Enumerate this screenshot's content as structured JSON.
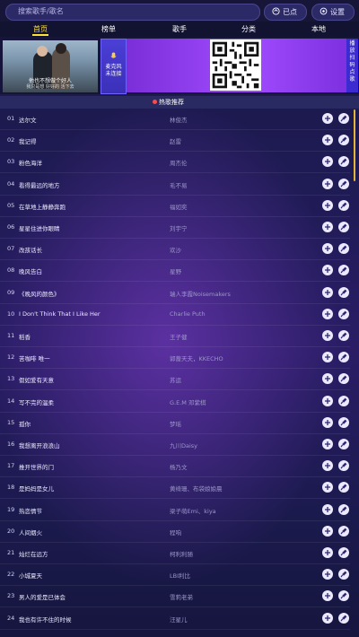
{
  "search": {
    "placeholder": "搜索歌手/歌名"
  },
  "header": {
    "queued_label": "已点",
    "settings_label": "设置"
  },
  "tabs": [
    {
      "label": "首页",
      "active": true
    },
    {
      "label": "榜单",
      "active": false
    },
    {
      "label": "歌手",
      "active": false
    },
    {
      "label": "分类",
      "active": false
    },
    {
      "label": "本地",
      "active": false
    }
  ],
  "banner": {
    "video_subtitle": "他也不想做个好人",
    "video_subtitle_small": "我只是想 好好的 活下去",
    "mic_label": [
      "麦克风",
      "未连接"
    ],
    "side_label": [
      "播",
      "放",
      "扫",
      "码",
      "点",
      "歌"
    ]
  },
  "section": {
    "title": "热歌推荐"
  },
  "songs": [
    {
      "num": "01",
      "title": "达尔文",
      "artist": "林俊杰"
    },
    {
      "num": "02",
      "title": "我记得",
      "artist": "赵雷"
    },
    {
      "num": "03",
      "title": "粉色海洋",
      "artist": "周杰伦"
    },
    {
      "num": "04",
      "title": "看得最远的地方",
      "artist": "毛不易"
    },
    {
      "num": "05",
      "title": "在草地上静静奔跑",
      "artist": "福如奕"
    },
    {
      "num": "06",
      "title": "星星住进你眼睛",
      "artist": "刘宇宁"
    },
    {
      "num": "07",
      "title": "改孩话长",
      "artist": "欢沙"
    },
    {
      "num": "08",
      "title": "晚风告白",
      "artist": "星野"
    },
    {
      "num": "09",
      "title": "《晚风的颜色》",
      "artist": "瑞人李霞Noisemakers"
    },
    {
      "num": "10",
      "title": "I Don't Think That I Like Her",
      "artist": "Charlie Puth"
    },
    {
      "num": "11",
      "title": "稻香",
      "artist": "王子健"
    },
    {
      "num": "12",
      "title": "苦咖啡 唯一",
      "artist": "郭蔷天夫，KKECHO"
    },
    {
      "num": "13",
      "title": "假如爱有天意",
      "artist": "苏运"
    },
    {
      "num": "14",
      "title": "写不完的温柔",
      "artist": "G.E.M 邓紫棋"
    },
    {
      "num": "15",
      "title": "孤你",
      "artist": "梦瑶"
    },
    {
      "num": "16",
      "title": "我想离开浪浪山",
      "artist": "九川Daisy"
    },
    {
      "num": "17",
      "title": "推开世界的门",
      "artist": "杨乃文"
    },
    {
      "num": "18",
      "title": "是妈妈是女儿",
      "artist": "黄绮珊、布袋娘娘晨"
    },
    {
      "num": "19",
      "title": "热恋情节",
      "artist": "梁子萌Emi、kiya"
    },
    {
      "num": "20",
      "title": "人间烟火",
      "artist": "程响"
    },
    {
      "num": "21",
      "title": "灿烂在远方",
      "artist": "柯利利随"
    },
    {
      "num": "22",
      "title": "小城夏天",
      "artist": "LBI利比"
    },
    {
      "num": "23",
      "title": "男人的爱是已体会",
      "artist": "雪莉老弟"
    },
    {
      "num": "24",
      "title": "我也有许不住的时候",
      "artist": "汪星儿"
    }
  ]
}
